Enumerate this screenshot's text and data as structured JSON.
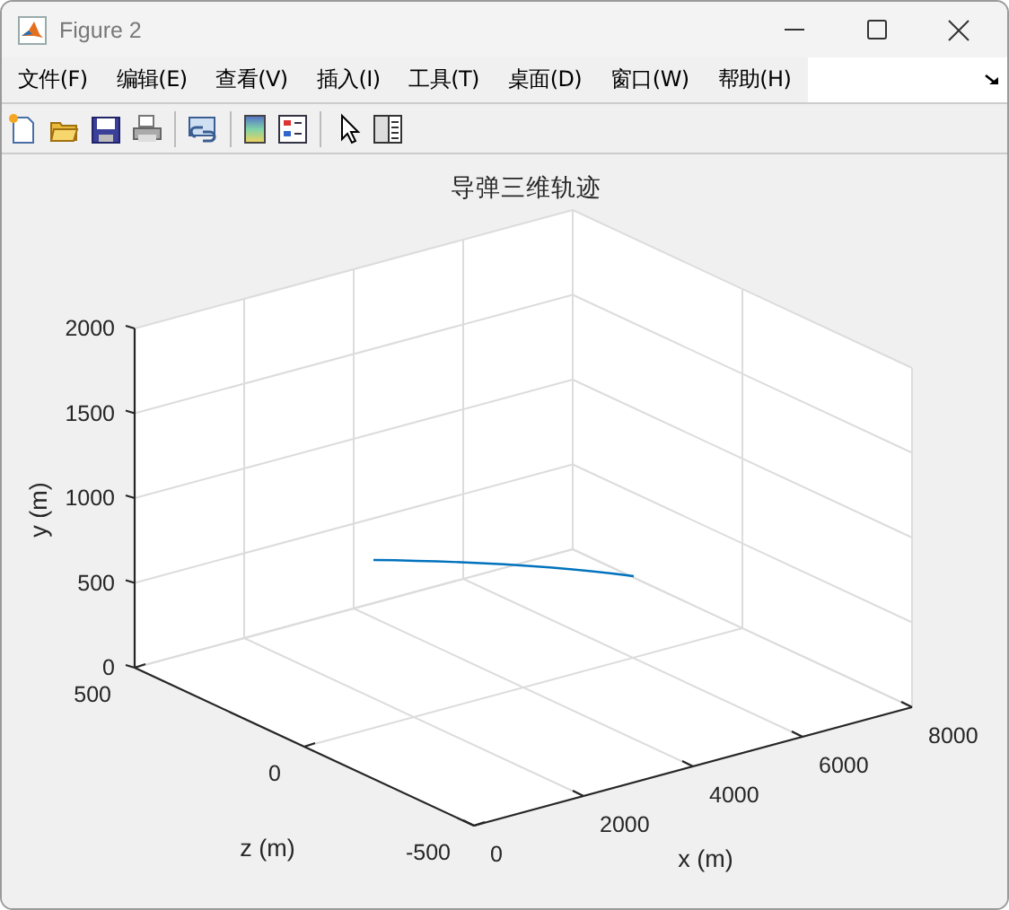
{
  "window": {
    "title": "Figure 2"
  },
  "menu": [
    {
      "label": "文件(F)"
    },
    {
      "label": "编辑(E)"
    },
    {
      "label": "查看(V)"
    },
    {
      "label": "插入(I)"
    },
    {
      "label": "工具(T)"
    },
    {
      "label": "桌面(D)"
    },
    {
      "label": "窗口(W)"
    },
    {
      "label": "帮助(H)"
    }
  ],
  "plot": {
    "title": "导弹三维轨迹",
    "xlabel": "x (m)",
    "ylabel": "y (m)",
    "zlabel": "z (m)",
    "xticks": [
      "0",
      "2000",
      "4000",
      "6000",
      "8000"
    ],
    "yticks": [
      "2000",
      "1500",
      "1000",
      "500",
      "0"
    ],
    "zticks": [
      "500",
      "0",
      "-500"
    ]
  }
}
